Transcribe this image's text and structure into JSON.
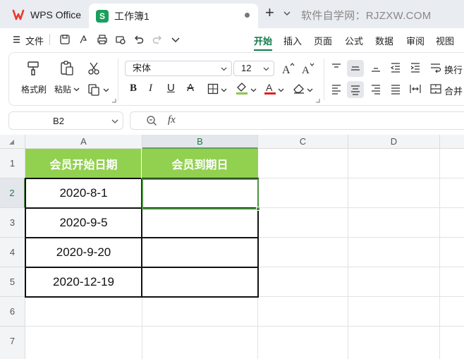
{
  "tabs": {
    "wps_label": "WPS Office",
    "doc_label": "工作簿1",
    "sheet_logo_letter": "S"
  },
  "watermark": "软件自学网：RJZXW.COM",
  "menu": {
    "file_label": "文件",
    "items": [
      "开始",
      "插入",
      "页面",
      "公式",
      "数据",
      "审阅",
      "视图"
    ],
    "active": "开始"
  },
  "ribbon": {
    "format_painter": "格式刷",
    "paste": "粘贴",
    "font_name": "宋体",
    "font_size": "12",
    "wrap_text": "换行",
    "merge": "合并"
  },
  "formula_bar": {
    "name_box": "B2",
    "fx_label": "fx"
  },
  "sheet": {
    "columns": [
      "A",
      "B",
      "C",
      "D"
    ],
    "rows": [
      "1",
      "2",
      "3",
      "4",
      "5",
      "6",
      "7"
    ],
    "selected_column": "B",
    "selected_row": "2",
    "header_color": "#92d050",
    "cells": {
      "A1": "会员开始日期",
      "B1": "会员到期日",
      "A2": "2020-8-1",
      "A3": "2020-9-5",
      "A4": "2020-9-20",
      "A5": "2020-12-19"
    }
  },
  "colors": {
    "accent_green": "#127a4a",
    "selection_green": "#4a9240",
    "wps_red": "#e8392f",
    "sheet_green": "#1a9f5d"
  }
}
